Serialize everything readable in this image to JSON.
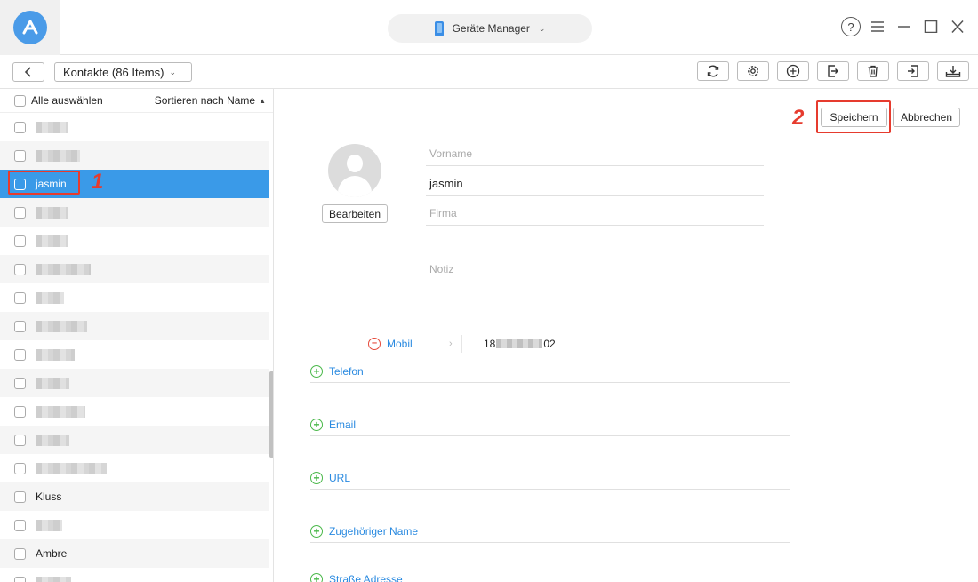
{
  "app": {
    "device_selector": "Geräte Manager"
  },
  "toolbar": {
    "category": "Kontakte (86 Items)"
  },
  "list": {
    "select_all": "Alle auswählen",
    "sort": "Sortieren nach Name",
    "items": [
      {
        "name": "",
        "pixelated": true,
        "width": 36
      },
      {
        "name": "",
        "pixelated": true,
        "width": 50
      },
      {
        "name": "jasmin",
        "pixelated": false,
        "selected": true
      },
      {
        "name": "",
        "pixelated": true,
        "width": 36
      },
      {
        "name": "",
        "pixelated": true,
        "width": 36
      },
      {
        "name": "",
        "pixelated": true,
        "width": 62
      },
      {
        "name": "",
        "pixelated": true,
        "width": 32
      },
      {
        "name": "",
        "pixelated": true,
        "width": 58
      },
      {
        "name": "",
        "pixelated": true,
        "width": 44
      },
      {
        "name": "",
        "pixelated": true,
        "width": 38
      },
      {
        "name": "",
        "pixelated": true,
        "width": 56
      },
      {
        "name": "",
        "pixelated": true,
        "width": 38
      },
      {
        "name": "",
        "pixelated": true,
        "width": 80
      },
      {
        "name": "Kluss",
        "pixelated": false
      },
      {
        "name": "",
        "pixelated": true,
        "width": 30
      },
      {
        "name": "Ambre",
        "pixelated": false
      },
      {
        "name": "",
        "pixelated": true,
        "width": 40
      }
    ]
  },
  "annotations": {
    "step1": "1",
    "step2": "2"
  },
  "detail": {
    "save": "Speichern",
    "cancel": "Abbrechen",
    "edit": "Bearbeiten",
    "first_name_placeholder": "Vorname",
    "last_name": "jasmin",
    "company_placeholder": "Firma",
    "note_placeholder": "Notiz",
    "mobile_label": "Mobil",
    "mobile_prefix": "18",
    "mobile_suffix": "02",
    "add_fields": [
      "Telefon",
      "Email",
      "URL",
      "Zugehöriger Name",
      "Straße Adresse"
    ]
  },
  "colors": {
    "accent": "#3a9ae8",
    "highlight": "#e63b2e",
    "add_green": "#4ab84a"
  }
}
